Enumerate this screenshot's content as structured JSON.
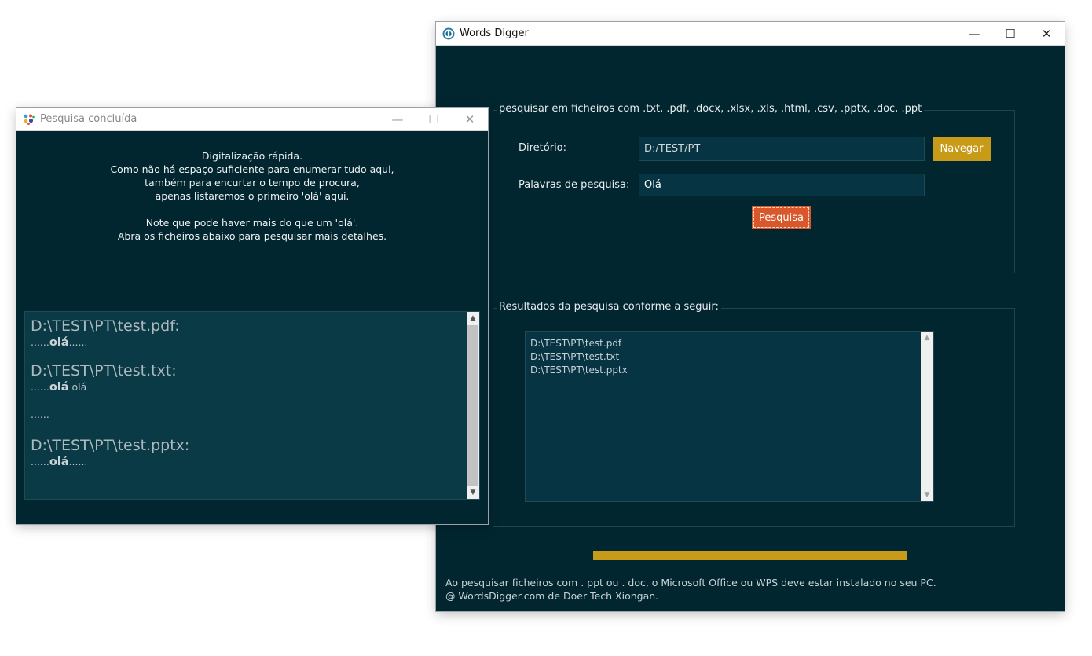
{
  "main_window": {
    "title": "Words Digger",
    "controls": {
      "minimize": "—",
      "maximize": "☐",
      "close": "✕"
    },
    "search_group": {
      "label": "pesquisar em ficheiros com .txt, .pdf, .docx, .xlsx, .xls, .html, .csv, .pptx, .doc, .ppt",
      "directory_label": "Diretório:",
      "directory_value": "D:/TEST/PT",
      "browse_button": "Navegar",
      "keywords_label": "Palavras de pesquisa:",
      "keywords_value": "Olá",
      "search_button": "Pesquisa"
    },
    "results_group": {
      "label": "Resultados da pesquisa conforme a seguir:",
      "items": [
        "D:\\TEST\\PT\\test.pdf",
        "D:\\TEST\\PT\\test.txt",
        "D:\\TEST\\PT\\test.pptx"
      ]
    },
    "progress": 1.0,
    "footer": {
      "line1": "Ao pesquisar ficheiros com . ppt ou . doc, o Microsoft Office ou WPS deve estar instalado no seu PC.",
      "line2": "@ WordsDigger.com de Doer Tech Xiongan."
    }
  },
  "dialog": {
    "title": "Pesquisa concluída",
    "controls": {
      "minimize": "—",
      "maximize": "☐",
      "close": "✕"
    },
    "message_lines": [
      "Digitalização rápida.",
      "Como não há espaço suficiente para enumerar tudo aqui,",
      "também para encurtar o tempo de procura,",
      "apenas listaremos o primeiro 'olá' aqui.",
      "",
      "Note que pode haver mais do que um 'olá'.",
      "Abra os ficheiros abaixo para pesquisar mais detalhes."
    ],
    "results": [
      {
        "file": "D:\\TEST\\PT\\test.pdf:",
        "prefix": "......",
        "match": "olá",
        "suffix": "......",
        "extra": ""
      },
      {
        "file": "D:\\TEST\\PT\\test.txt:",
        "prefix": "......",
        "match": "olá",
        "suffix": " olá",
        "extra": "......"
      },
      {
        "file": "D:\\TEST\\PT\\test.pptx:",
        "prefix": "......",
        "match": "olá",
        "suffix": "......",
        "extra": ""
      }
    ]
  },
  "colors": {
    "background": "#022630",
    "accent_gold": "#c79a18",
    "accent_orange": "#d8582c"
  },
  "icons": {
    "main": "words-digger-app-icon",
    "dialog": "colored-dots-app-icon"
  }
}
